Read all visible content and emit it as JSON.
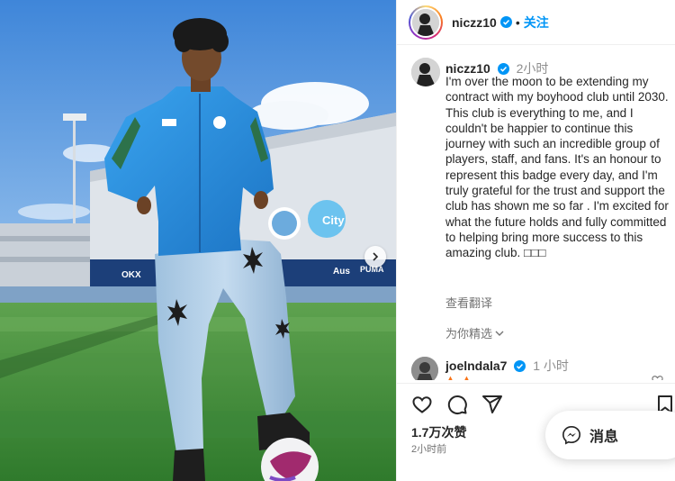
{
  "colors": {
    "accent": "#0095f6",
    "text": "#262626",
    "muted": "#737373",
    "sky": "#4f8fd6",
    "grass": "#3f8a3a",
    "kit_blue": "#2a8fd8"
  },
  "post": {
    "author": "niczz10",
    "follow_label": "关注",
    "separator": "•",
    "caption_time": "2小时",
    "caption": "I'm over the moon to be extending my contract with my boyhood club until 2030. This club is everything to me, and I couldn't be happier to continue this journey with such an incredible group of players, staff, and fans. It's an honour to represent this badge every day, and I'm truly grateful for the trust and support the club has shown me so far . I'm excited for what the future holds and fully committed to helping bring more success to this amazing club. □□□",
    "translate_label": "查看翻译",
    "featured_label": "为你精选",
    "likes": "1.7万次赞",
    "posted_time": "2小时前"
  },
  "comment": {
    "username": "joelndala7",
    "time": "1 小时",
    "emoji": "▲ ▲"
  },
  "photo": {
    "banner_text": "City",
    "boards": [
      "OKX",
      "Aus",
      "PUMA"
    ]
  },
  "icons": {
    "verified": "verified-badge-icon",
    "like": "heart-icon",
    "comment": "comment-icon",
    "share": "share-icon",
    "save": "bookmark-icon",
    "next": "chevron-right-icon",
    "messages": "messenger-icon",
    "featured_toggle": "chevron-down-icon"
  },
  "messages_label": "消息"
}
